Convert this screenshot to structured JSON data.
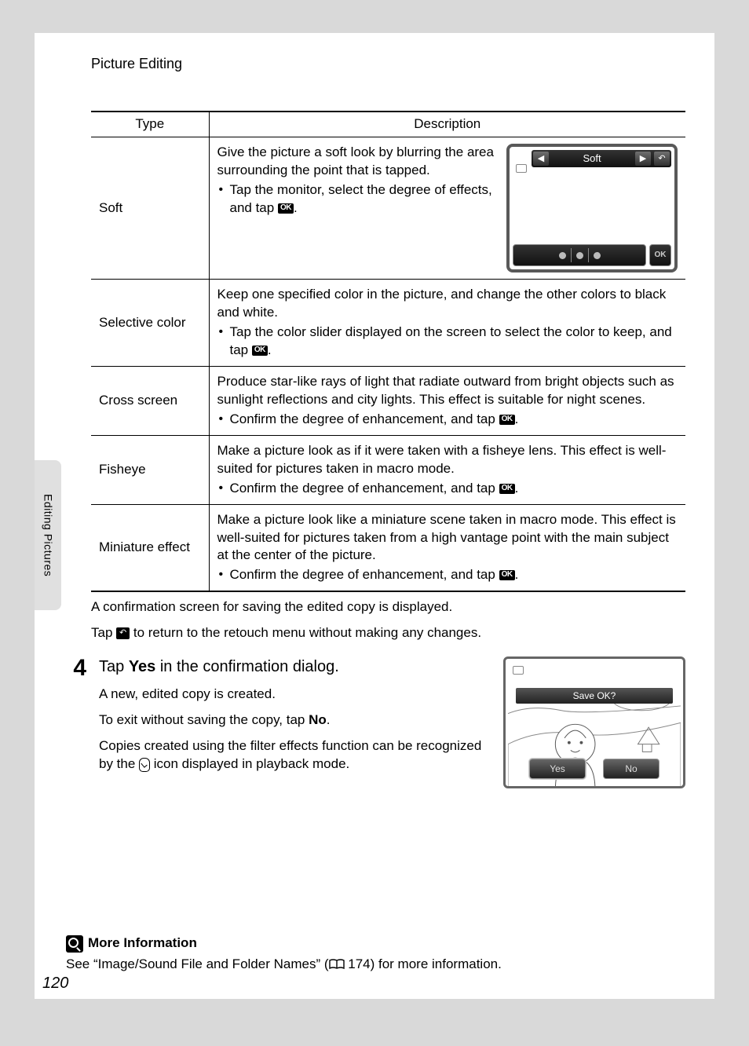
{
  "header": "Picture Editing",
  "side_tab": "Editing Pictures",
  "page_number": "120",
  "icons": {
    "ok_label": "OK"
  },
  "table": {
    "headers": {
      "type": "Type",
      "description": "Description"
    },
    "rows": [
      {
        "type": "Soft",
        "desc": "Give the picture a soft look by blurring the area surrounding the point that is tapped.",
        "bullet": "Tap the monitor, select the degree of effects, and tap ",
        "bullet_tail": ".",
        "has_preview": true,
        "preview_title": "Soft",
        "preview_ok": "OK"
      },
      {
        "type": "Selective color",
        "desc": "Keep one specified color in the picture, and change the other colors to black and white.",
        "bullet": "Tap the color slider displayed on the screen to select the color to keep, and tap ",
        "bullet_tail": "."
      },
      {
        "type": "Cross screen",
        "desc": "Produce star-like rays of light that radiate outward from bright objects such as sunlight reflections and city lights. This effect is suitable for night scenes.",
        "bullet": "Confirm the degree of enhancement, and tap ",
        "bullet_tail": "."
      },
      {
        "type": "Fisheye",
        "desc": "Make a picture look as if it were taken with a fisheye lens. This effect is well-suited for pictures taken in macro mode.",
        "bullet": "Confirm the degree of enhancement, and tap ",
        "bullet_tail": "."
      },
      {
        "type": "Miniature effect",
        "desc": "Make a picture look like a miniature scene taken in macro mode. This effect is well-suited for pictures taken from a high vantage point with the main subject at the center of the picture.",
        "bullet": "Confirm the degree of enhancement, and tap ",
        "bullet_tail": "."
      }
    ]
  },
  "after_table": {
    "line1": "A confirmation screen for saving the edited copy is displayed.",
    "line2a": "Tap ",
    "line2b": " to return to the retouch menu without making any changes."
  },
  "step4": {
    "num": "4",
    "title_a": "Tap ",
    "title_bold": "Yes",
    "title_b": " in the confirmation dialog.",
    "p1": "A new, edited copy is created.",
    "p2a": "To exit without saving the copy, tap ",
    "p2bold": "No",
    "p2b": ".",
    "p3a": "Copies created using the filter effects function can be recognized by the ",
    "p3b": " icon displayed in playback mode.",
    "confirm": {
      "save": "Save OK?",
      "yes": "Yes",
      "no": "No"
    }
  },
  "more_info": {
    "title": "More Information",
    "text_a": "See “Image/Sound File and Folder Names” (",
    "text_page": "174",
    "text_b": ") for more information."
  }
}
